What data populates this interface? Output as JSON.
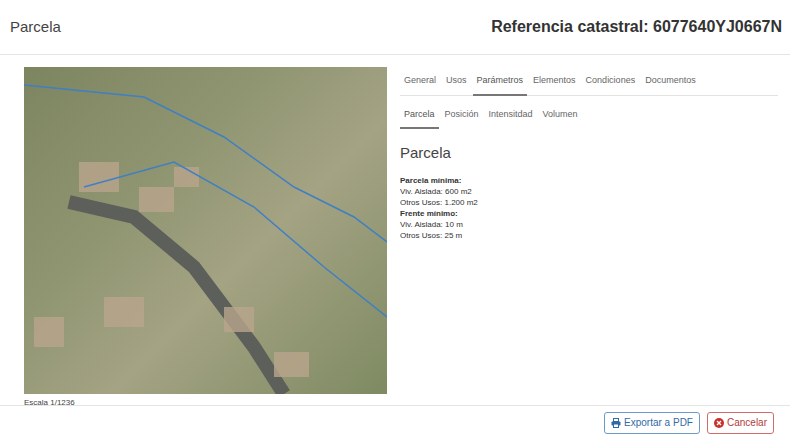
{
  "header": {
    "title": "Parcela",
    "reference": "Referencia catastral: 6077640YJ0667N"
  },
  "map": {
    "scale": "Escala 1/1236"
  },
  "tabs": [
    {
      "label": "General",
      "selected": false
    },
    {
      "label": "Usos",
      "selected": false
    },
    {
      "label": "Parámetros",
      "selected": true
    },
    {
      "label": "Elementos",
      "selected": false
    },
    {
      "label": "Condiciones",
      "selected": false
    },
    {
      "label": "Documentos",
      "selected": false
    }
  ],
  "subtabs": [
    {
      "label": "Parcela",
      "selected": true
    },
    {
      "label": "Posición",
      "selected": false
    },
    {
      "label": "Intensitdad",
      "selected": false
    },
    {
      "label": "Volumen",
      "selected": false
    }
  ],
  "section": {
    "title": "Parcela",
    "groups": [
      {
        "title": "Parcela mínima:",
        "lines": [
          "Viv. Aislada: 600 m2",
          "Otros Usos: 1.200 m2"
        ]
      },
      {
        "title": "Frente mínimo:",
        "lines": [
          "Viv. Aislada: 10 m",
          "Otros Usos: 25 m"
        ]
      }
    ]
  },
  "buttons": [
    {
      "label": "Exportar a PDF",
      "kind": "export"
    },
    {
      "label": "Cancelar",
      "kind": "cancel"
    }
  ]
}
